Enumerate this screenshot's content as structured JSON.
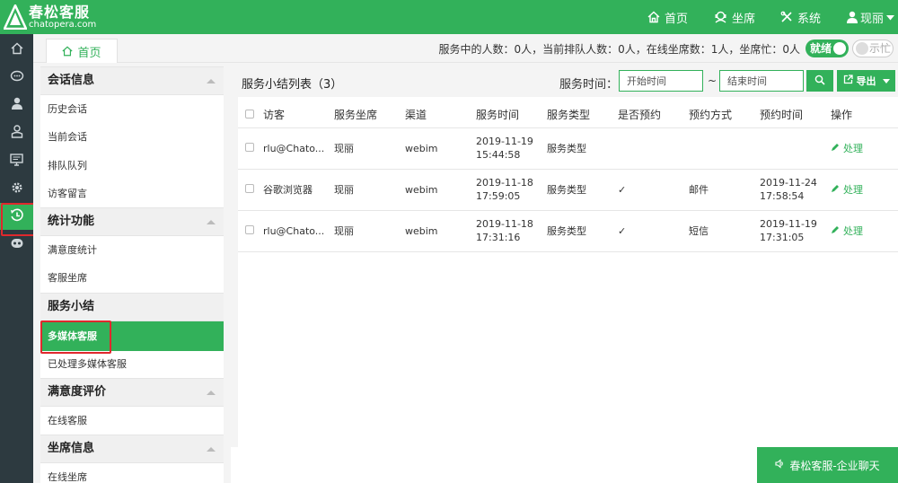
{
  "brand": {
    "name": "春松客服",
    "url": "chatopera.com"
  },
  "topnav": {
    "home": "首页",
    "seat": "坐席",
    "system": "系统",
    "user": "现丽"
  },
  "subbar": {
    "home_tab": "首页",
    "status_text": "服务中的人数：0人，当前排队人数：0人，在线坐席数：1人，坐席忙：0人",
    "ready_label": "就绪",
    "busy_label": "示忙"
  },
  "sidebar": {
    "sections": [
      {
        "title": "会话信息",
        "items": [
          "历史会话",
          "当前会话",
          "排队队列",
          "访客留言"
        ]
      },
      {
        "title": "统计功能",
        "items": [
          "满意度统计",
          "客服坐席"
        ]
      },
      {
        "title": "服务小结",
        "items": [
          "多媒体客服",
          "已处理多媒体客服"
        ]
      },
      {
        "title": "满意度评价",
        "items": [
          "在线客服"
        ]
      },
      {
        "title": "坐席信息",
        "items": [
          "在线坐席"
        ]
      }
    ],
    "active_item": "多媒体客服"
  },
  "main": {
    "title": "服务小结列表（3）",
    "time_label": "服务时间：",
    "start_placeholder": "开始时间",
    "tilde": "~",
    "end_placeholder": "结束时间",
    "export_label": "导出",
    "columns": [
      "访客",
      "服务坐席",
      "渠道",
      "服务时间",
      "服务类型",
      "是否预约",
      "预约方式",
      "预约时间",
      "操作"
    ],
    "rows": [
      {
        "visitor": "rlu@Chato...",
        "agent": "现丽",
        "channel": "webim",
        "date": "2019-11-19",
        "time": "15:44:58",
        "type": "服务类型",
        "booked": "",
        "method": "",
        "bdate": "",
        "btime": "",
        "action": "处理"
      },
      {
        "visitor": "谷歌浏览器",
        "agent": "现丽",
        "channel": "webim",
        "date": "2019-11-18",
        "time": "17:59:05",
        "type": "服务类型",
        "booked": "✓",
        "method": "邮件",
        "bdate": "2019-11-24",
        "btime": "17:58:54",
        "action": "处理"
      },
      {
        "visitor": "rlu@Chato...",
        "agent": "现丽",
        "channel": "webim",
        "date": "2019-11-18",
        "time": "17:31:16",
        "type": "服务类型",
        "booked": "✓",
        "method": "短信",
        "bdate": "2019-11-19",
        "btime": "17:31:05",
        "action": "处理"
      }
    ]
  },
  "chatbar": {
    "label": "春松客服-企业聊天"
  },
  "colors": {
    "accent": "#32b15a",
    "sidebar_dark": "#2d3a40",
    "highlight_red": "#e0282d"
  }
}
